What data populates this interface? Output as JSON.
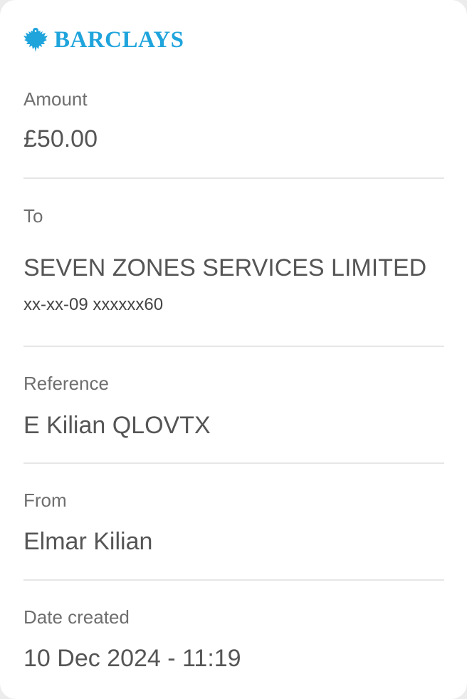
{
  "brand": {
    "name": "BARCLAYS",
    "logo_icon": "eagle-icon",
    "color": "#1fa4dc"
  },
  "amount": {
    "label": "Amount",
    "value": "£50.00"
  },
  "to": {
    "label": "To",
    "name": "SEVEN ZONES SERVICES LIMITED",
    "account": "xx-xx-09 xxxxxx60"
  },
  "reference": {
    "label": "Reference",
    "value": "E Kilian QLOVTX"
  },
  "from": {
    "label": "From",
    "value": "Elmar Kilian"
  },
  "date_created": {
    "label": "Date created",
    "value": "10 Dec 2024 - 11:19"
  }
}
